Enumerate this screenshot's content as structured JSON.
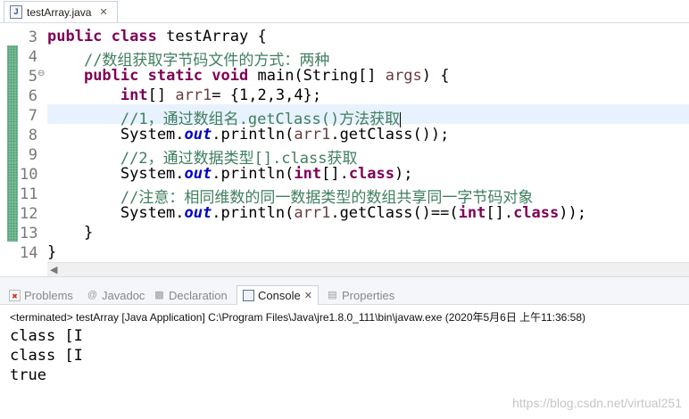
{
  "editor_tab": {
    "label": "testArray.java",
    "close_glyph": "✕",
    "icon_letter": "J"
  },
  "code_lines": [
    {
      "num": "3",
      "fold": "",
      "tokens": [
        [
          "kw",
          "public"
        ],
        [
          "p",
          " "
        ],
        [
          "kw",
          "class"
        ],
        [
          "p",
          " testArray {"
        ]
      ]
    },
    {
      "num": "4",
      "fold": "",
      "tokens": [
        [
          "p",
          "    "
        ],
        [
          "cm",
          "//数组获取字节码文件的方式：两种"
        ]
      ]
    },
    {
      "num": "5",
      "fold": "⊖",
      "tokens": [
        [
          "p",
          "    "
        ],
        [
          "kw",
          "public"
        ],
        [
          "p",
          " "
        ],
        [
          "kw",
          "static"
        ],
        [
          "p",
          " "
        ],
        [
          "kw",
          "void"
        ],
        [
          "p",
          " main(String[] "
        ],
        [
          "var",
          "args"
        ],
        [
          "p",
          ") {"
        ]
      ]
    },
    {
      "num": "6",
      "fold": "",
      "tokens": [
        [
          "p",
          "        "
        ],
        [
          "kw",
          "int"
        ],
        [
          "p",
          "[] "
        ],
        [
          "var",
          "arr1"
        ],
        [
          "p",
          "= {1,2,3,4};"
        ]
      ]
    },
    {
      "num": "7",
      "fold": "",
      "tokens": [
        [
          "p",
          "        "
        ],
        [
          "cm",
          "//1，通过数组名.getClass()方法获取"
        ]
      ]
    },
    {
      "num": "8",
      "fold": "",
      "tokens": [
        [
          "p",
          "        System."
        ],
        [
          "fld",
          "out"
        ],
        [
          "p",
          ".println("
        ],
        [
          "var",
          "arr1"
        ],
        [
          "p",
          ".getClass());"
        ]
      ]
    },
    {
      "num": "9",
      "fold": "",
      "tokens": [
        [
          "p",
          "        "
        ],
        [
          "cm",
          "//2，通过数据类型[].class获取"
        ]
      ]
    },
    {
      "num": "10",
      "fold": "",
      "tokens": [
        [
          "p",
          "        System."
        ],
        [
          "fld",
          "out"
        ],
        [
          "p",
          ".println("
        ],
        [
          "kw",
          "int"
        ],
        [
          "p",
          "[]."
        ],
        [
          "kw",
          "class"
        ],
        [
          "p",
          ");"
        ]
      ]
    },
    {
      "num": "11",
      "fold": "",
      "tokens": [
        [
          "p",
          "        "
        ],
        [
          "cm",
          "//注意：相同维数的同一数据类型的数组共享同一字节码对象"
        ]
      ]
    },
    {
      "num": "12",
      "fold": "",
      "tokens": [
        [
          "p",
          "        System."
        ],
        [
          "fld",
          "out"
        ],
        [
          "p",
          ".println("
        ],
        [
          "var",
          "arr1"
        ],
        [
          "p",
          ".getClass()==("
        ],
        [
          "kw",
          "int"
        ],
        [
          "p",
          "[]."
        ],
        [
          "kw",
          "class"
        ],
        [
          "p",
          "));"
        ]
      ]
    },
    {
      "num": "13",
      "fold": "",
      "tokens": [
        [
          "p",
          "    }"
        ]
      ]
    },
    {
      "num": "14",
      "fold": "",
      "tokens": [
        [
          "p",
          "}"
        ]
      ]
    }
  ],
  "current_line": "7",
  "views": {
    "tabs": [
      {
        "label": "Problems",
        "icon": "problems-icon"
      },
      {
        "label": "Javadoc",
        "icon": "javadoc-icon",
        "glyph": "@"
      },
      {
        "label": "Declaration",
        "icon": "declaration-icon"
      },
      {
        "label": "Console",
        "icon": "console-icon",
        "active": true,
        "close_glyph": "✕"
      },
      {
        "label": "Properties",
        "icon": "properties-icon"
      }
    ]
  },
  "console": {
    "header": "<terminated> testArray [Java Application] C:\\Program Files\\Java\\jre1.8.0_111\\bin\\javaw.exe (2020年5月6日 上午11:36:58)",
    "output": [
      "class [I",
      "class [I",
      "true"
    ]
  },
  "watermark": "https://blog.csdn.net/virtual251",
  "colors": {
    "keyword": "#7f0055",
    "comment": "#3f7f5f",
    "static_field": "#0000c0",
    "local_var": "#6a3e3e",
    "current_line": "#e8f2fe"
  }
}
